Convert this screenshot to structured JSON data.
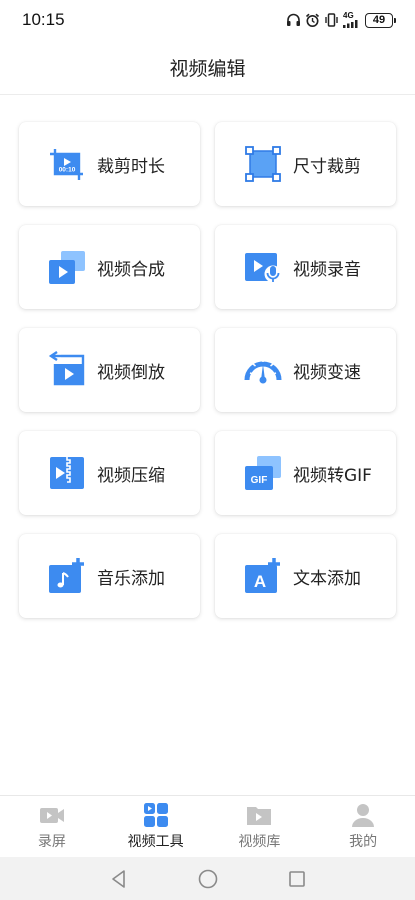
{
  "status_bar": {
    "time": "10:15",
    "network": "4G",
    "battery": "49"
  },
  "header": {
    "title": "视频编辑"
  },
  "tools": [
    {
      "label": "裁剪时长",
      "icon": "crop-duration-icon",
      "badge": "00:10"
    },
    {
      "label": "尺寸裁剪",
      "icon": "resize-crop-icon"
    },
    {
      "label": "视频合成",
      "icon": "video-merge-icon"
    },
    {
      "label": "视频录音",
      "icon": "video-record-audio-icon"
    },
    {
      "label": "视频倒放",
      "icon": "video-reverse-icon"
    },
    {
      "label": "视频变速",
      "icon": "speedometer-icon"
    },
    {
      "label": "视频压缩",
      "icon": "zip-compress-icon"
    },
    {
      "label": "视频转GIF",
      "icon": "gif-convert-icon",
      "badge": "GIF"
    },
    {
      "label": "音乐添加",
      "icon": "add-music-icon"
    },
    {
      "label": "文本添加",
      "icon": "add-text-icon",
      "badge": "A"
    }
  ],
  "bottom_nav": [
    {
      "label": "录屏",
      "icon": "screen-record-icon",
      "active": false
    },
    {
      "label": "视频工具",
      "icon": "video-tools-icon",
      "active": true
    },
    {
      "label": "视频库",
      "icon": "video-library-icon",
      "active": false
    },
    {
      "label": "我的",
      "icon": "profile-icon",
      "active": false
    }
  ],
  "colors": {
    "accent_blue": "#3d8bf0",
    "accent_light": "#8ec3ff",
    "nav_inactive": "#c4c4c4"
  }
}
